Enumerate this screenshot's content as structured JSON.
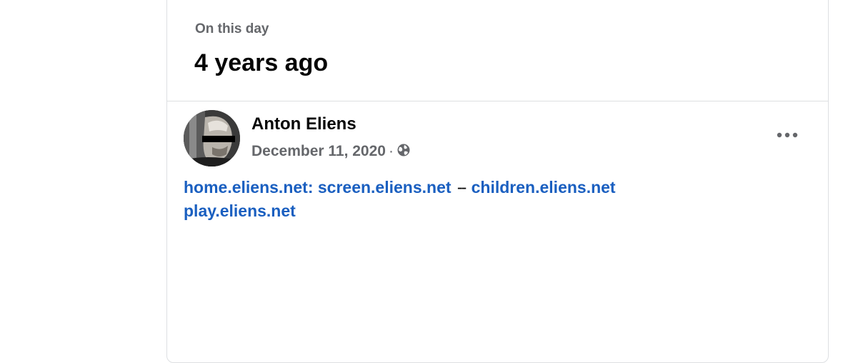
{
  "memory": {
    "label": "On this day",
    "title": "4 years ago"
  },
  "post": {
    "author": "Anton Eliens",
    "date": "December 11, 2020",
    "separator": "·",
    "audience_icon": "globe-icon",
    "more_icon": "more-options-icon",
    "links": [
      "home.eliens.net: screen.eliens.net",
      "children.eliens.net",
      "play.eliens.net"
    ],
    "link_separator": "--"
  },
  "colors": {
    "link": "#1a5fc0",
    "secondary_text": "#65676b",
    "primary_text": "#050505",
    "border": "#dddfe2"
  }
}
